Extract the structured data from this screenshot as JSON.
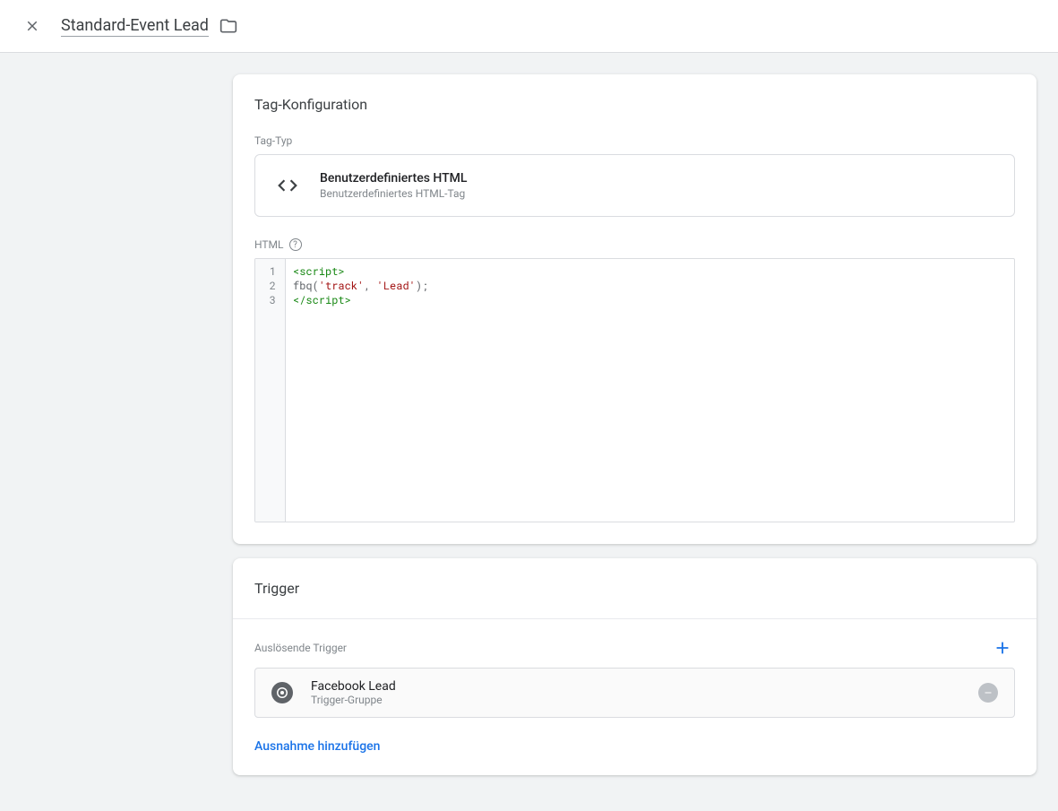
{
  "header": {
    "title": "Standard-Event Lead"
  },
  "tagConfig": {
    "sectionTitle": "Tag-Konfiguration",
    "tagTypeLabel": "Tag-Typ",
    "tagType": {
      "title": "Benutzerdefiniertes HTML",
      "subtitle": "Benutzerdefiniertes HTML-Tag"
    },
    "htmlLabel": "HTML",
    "code": {
      "lines": [
        "1",
        "2",
        "3"
      ],
      "tokens": [
        [
          {
            "t": "tag",
            "v": "<script>"
          }
        ],
        [
          {
            "t": "ident",
            "v": "fbq"
          },
          {
            "t": "punc",
            "v": "("
          },
          {
            "t": "str",
            "v": "'track'"
          },
          {
            "t": "punc",
            "v": ", "
          },
          {
            "t": "str",
            "v": "'Lead'"
          },
          {
            "t": "punc",
            "v": ");"
          }
        ],
        [
          {
            "t": "tag",
            "v": "</script>"
          }
        ]
      ]
    }
  },
  "trigger": {
    "sectionTitle": "Trigger",
    "firingLabel": "Auslösende Trigger",
    "item": {
      "title": "Facebook Lead",
      "subtitle": "Trigger-Gruppe"
    },
    "addException": "Ausnahme hinzufügen"
  }
}
